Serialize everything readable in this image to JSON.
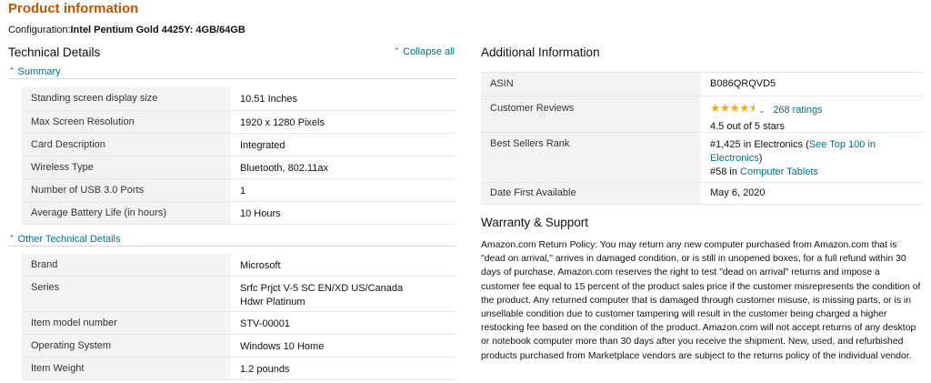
{
  "page": {
    "title": "Product information",
    "configuration_label": "Configuration:",
    "configuration_value": "Intel Pentium Gold 4425Y: 4GB/64GB"
  },
  "technical_details": {
    "heading": "Technical Details",
    "collapse_all": "Collapse all",
    "summary_label": "Summary",
    "summary_rows": [
      {
        "key": "Standing screen display size",
        "value": "10.51 Inches"
      },
      {
        "key": "Max Screen Resolution",
        "value": "1920 x 1280 Pixels"
      },
      {
        "key": "Card Description",
        "value": "Integrated"
      },
      {
        "key": "Wireless Type",
        "value": "Bluetooth, 802.11ax"
      },
      {
        "key": "Number of USB 3.0 Ports",
        "value": "1"
      },
      {
        "key": "Average Battery Life (in hours)",
        "value": "10 Hours"
      }
    ],
    "other_label": "Other Technical Details",
    "other_rows": [
      {
        "key": "Brand",
        "value": "Microsoft"
      },
      {
        "key": "Series",
        "value": "Srfc Prjct V-5 SC EN/XD US/Canada Hdwr Platinum"
      },
      {
        "key": "Item model number",
        "value": "STV-00001"
      },
      {
        "key": "Operating System",
        "value": "Windows 10 Home"
      },
      {
        "key": "Item Weight",
        "value": "1.2 pounds"
      }
    ]
  },
  "additional_info": {
    "heading": "Additional Information",
    "asin_key": "ASIN",
    "asin_value": "B086QRQVD5",
    "reviews_key": "Customer Reviews",
    "ratings_count": "268 ratings",
    "rating_text": "4.5 out of 5 stars",
    "rating_value": 4.5,
    "rank_key": "Best Sellers Rank",
    "rank1_text": "#1,425 in Electronics (",
    "rank1_link": "See Top 100 in Electronics",
    "rank1_close": ")",
    "rank2_text": "#58 in ",
    "rank2_link": "Computer Tablets",
    "date_key": "Date First Available",
    "date_value": "May 6, 2020"
  },
  "warranty": {
    "heading": "Warranty & Support",
    "text": "Amazon.com Return Policy: You may return any new computer purchased from Amazon.com that is \"dead on arrival,\" arrives in damaged condition, or is still in unopened boxes, for a full refund within 30 days of purchase. Amazon.com reserves the right to test \"dead on arrival\" returns and impose a customer fee equal to 15 percent of the product sales price if the customer misrepresents the condition of the product. Any returned computer that is damaged through customer misuse, is missing parts, or is in unsellable condition due to customer tampering will result in the customer being charged a higher restocking fee based on the condition of the product. Amazon.com will not accept returns of any desktop or notebook computer more than 30 days after you receive the shipment. New, used, and refurbished products purchased from Marketplace vendors are subject to the returns policy of the individual vendor."
  },
  "colors": {
    "title": "#c45500",
    "link": "#007185",
    "star": "#ffa41c",
    "key_bg": "#f3f3f3"
  },
  "icons": {
    "collapse": "caret-up-icon",
    "section": "caret-up-icon",
    "rating_popover": "chevron-down-icon"
  }
}
